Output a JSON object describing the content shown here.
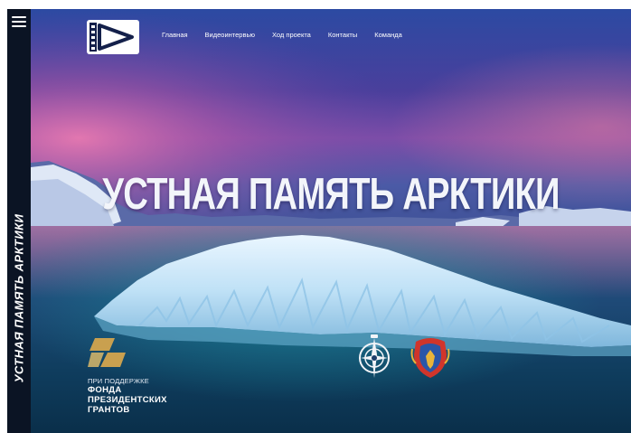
{
  "side_title": "УСТНАЯ ПАМЯТЬ АРКТИКИ",
  "nav": {
    "items": [
      "Главная",
      "Видеоинтервью",
      "Ход проекта",
      "Контакты",
      "Команда"
    ]
  },
  "hero": {
    "title": "УСТНАЯ ПАМЯТЬ АРКТИКИ"
  },
  "grant": {
    "small": "ПРИ ПОДДЕРЖКЕ",
    "line1": "ФОНДА",
    "line2": "ПРЕЗИДЕНТСКИХ",
    "line3": "ГРАНТОВ"
  },
  "colors": {
    "sidebar": "#0b1424",
    "sky_top": "#2f4aa0",
    "sky_glow": "#d46aa8",
    "ice": "#d8ecfa",
    "water": "#123a63",
    "gold": "#c8a050",
    "emblem_red": "#d0352b"
  },
  "icons": [
    "menu-icon",
    "play-film-logo-icon",
    "grant-fund-logo-icon",
    "compass-emblem-icon",
    "crest-emblem-icon"
  ]
}
